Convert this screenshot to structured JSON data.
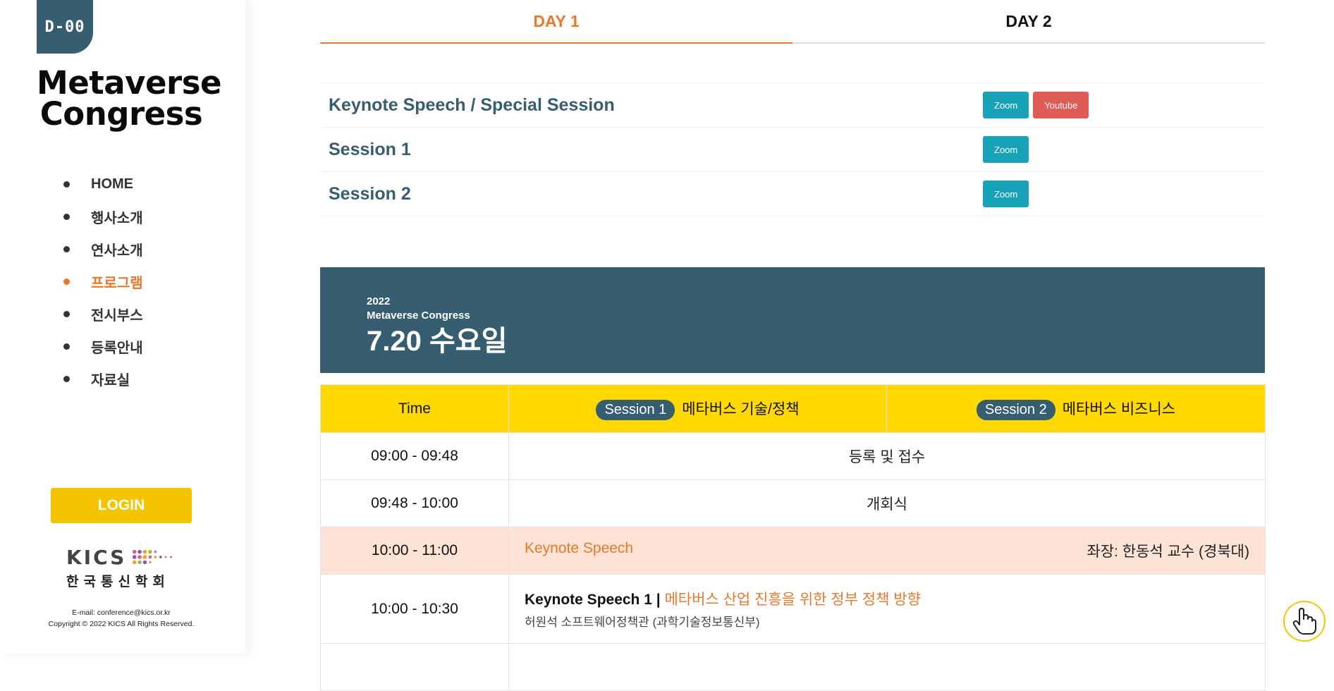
{
  "sidebar": {
    "dday": "D-00",
    "logo_line1": "Metaverse",
    "logo_line2": "Congress",
    "nav": [
      {
        "label": "HOME"
      },
      {
        "label": "행사소개"
      },
      {
        "label": "연사소개"
      },
      {
        "label": "프로그램"
      },
      {
        "label": "전시부스"
      },
      {
        "label": "등록안내"
      },
      {
        "label": "자료실"
      }
    ],
    "login_label": "LOGIN",
    "kics_letters": "KICS",
    "kics_korean": "한국통신학회",
    "footer_email": "E-mail: conference@kics.or.kr",
    "footer_copyright": "Copyright © 2022 KICS All Rights Reserved."
  },
  "tabs": [
    {
      "label": "DAY 1"
    },
    {
      "label": "DAY 2"
    }
  ],
  "links": [
    {
      "title": "Keynote Speech / Special Session",
      "zoom": "Zoom",
      "youtube": "Youtube"
    },
    {
      "title": "Session 1",
      "zoom": "Zoom"
    },
    {
      "title": "Session 2",
      "zoom": "Zoom"
    }
  ],
  "banner": {
    "year": "2022",
    "conference": "Metaverse Congress",
    "day": "7.20 수요일"
  },
  "program": {
    "header": {
      "time": "Time",
      "s1_pill": "Session 1",
      "s1_title": "메타버스 기술/정책",
      "s2_pill": "Session 2",
      "s2_title": "메타버스 비즈니스"
    },
    "rows": [
      {
        "time": "09:00 - 09:48",
        "text": "등록 및 접수"
      },
      {
        "time": "09:48 - 10:00",
        "text": "개회식"
      },
      {
        "time": "10:00 - 11:00",
        "title": "Keynote Speech",
        "chair": "좌장: 한동석 교수 (경북대)"
      },
      {
        "time": "10:00 - 10:30",
        "label": "Keynote Speech 1 |",
        "topic": "메타버스 산업 진흥을 위한 정부 정책 방향",
        "speaker": "허원석 소프트웨어정책관 (과학기술정보통신부)"
      }
    ]
  },
  "colors": {
    "accent": "#e8792b",
    "primary": "#365e70",
    "header_yellow": "#ffd800",
    "zoom": "#17a2b8",
    "youtube": "#e05a56",
    "login": "#f5c400"
  },
  "icons": {
    "cursor": "hand-pointer-icon"
  }
}
